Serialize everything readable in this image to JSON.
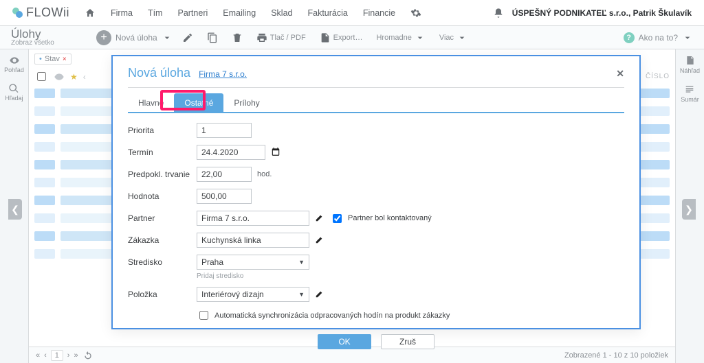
{
  "brand": "FLOWii",
  "topnav": {
    "items": [
      "Firma",
      "Tím",
      "Partneri",
      "Emailing",
      "Sklad",
      "Fakturácia",
      "Financie"
    ],
    "account": "ÚSPEŠNÝ PODNIKATEĽ s.r.o., Patrik Škulavík"
  },
  "page": {
    "title": "Úlohy",
    "subtitle": "Zobraz všetko",
    "new_label": "Nová úloha",
    "print_label": "Tlač / PDF",
    "export_label": "Export…",
    "bulk_label": "Hromadne",
    "more_label": "Viac",
    "help_label": "Ako na to?"
  },
  "filter_tab": {
    "label": "Stav",
    "close": "×"
  },
  "grid_head": {
    "num": "ČÍSLO"
  },
  "sidebar": {
    "left": [
      {
        "label": "Pohľad"
      },
      {
        "label": "Hľadaj"
      }
    ],
    "right": [
      {
        "label": "Náhľad"
      },
      {
        "label": "Sumár"
      }
    ]
  },
  "status": {
    "page": "1",
    "summary": "Zobrazené 1 - 10 z 10 položiek"
  },
  "modal": {
    "title": "Nová úloha",
    "company_link": "Firma 7 s.r.o.",
    "tabs": [
      "Hlavné",
      "Ostatné",
      "Prílohy"
    ],
    "fields": {
      "priorita": {
        "label": "Priorita",
        "value": "1"
      },
      "termin": {
        "label": "Termín",
        "value": "24.4.2020"
      },
      "trvanie": {
        "label": "Predpokl. trvanie",
        "value": "22,00",
        "unit": "hod."
      },
      "hodnota": {
        "label": "Hodnota",
        "value": "500,00"
      },
      "partner": {
        "label": "Partner",
        "value": "Firma 7 s.r.o.",
        "contacted": "Partner bol kontaktovaný"
      },
      "zakazka": {
        "label": "Zákazka",
        "value": "Kuchynská linka"
      },
      "stredisko": {
        "label": "Stredisko",
        "value": "Praha",
        "add_hint": "Pridaj stredisko"
      },
      "polozka": {
        "label": "Položka",
        "value": "Interiérový dizajn",
        "sync": "Automatická synchronizácia odpracovaných hodín na produkt zákazky"
      }
    },
    "buttons": {
      "ok": "OK",
      "cancel": "Zruš"
    }
  }
}
